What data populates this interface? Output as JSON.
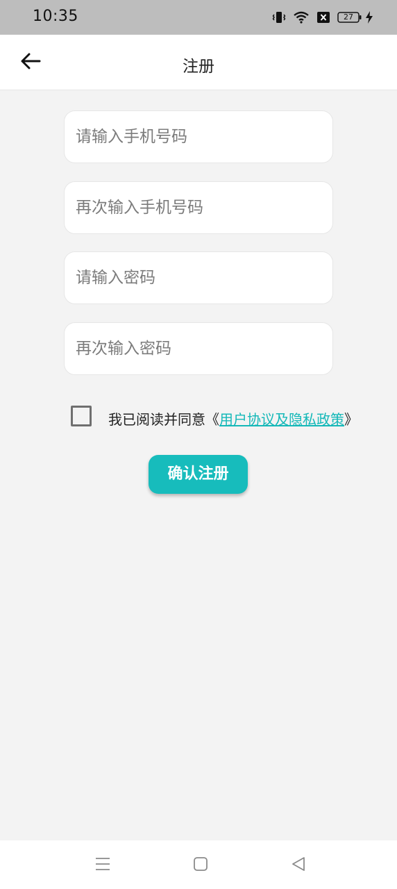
{
  "status_bar": {
    "time": "10:35",
    "battery_level": "27",
    "icons": [
      "vibrate-icon",
      "wifi-icon",
      "notification-x-icon",
      "battery-icon",
      "charging-bolt-icon"
    ]
  },
  "header": {
    "title": "注册",
    "back_icon": "arrow-left-icon"
  },
  "form": {
    "phone_placeholder": "请输入手机号码",
    "phone_value": "",
    "phone_confirm_placeholder": "再次输入手机号码",
    "phone_confirm_value": "",
    "password_placeholder": "请输入密码",
    "password_value": "",
    "password_confirm_placeholder": "再次输入密码",
    "password_confirm_value": ""
  },
  "agreement": {
    "checked": false,
    "prefix": "我已阅读并同意《",
    "link_text": "用户协议及隐私政策",
    "suffix": "》"
  },
  "submit": {
    "label": "确认注册"
  },
  "nav_bar": {
    "icons": [
      "menu-icon",
      "home-square-icon",
      "back-triangle-icon"
    ]
  },
  "colors": {
    "accent": "#17bcbc",
    "link": "#14b8b8",
    "background": "#f3f3f3",
    "status_bar": "#bdbdbd"
  }
}
